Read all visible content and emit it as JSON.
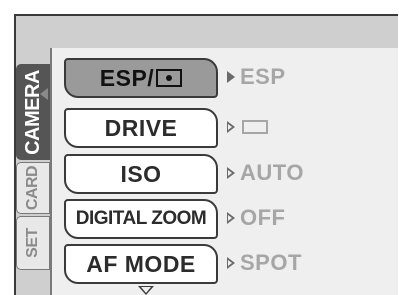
{
  "side_tabs": [
    {
      "label": "CAMERA",
      "active": true
    },
    {
      "label": "CARD",
      "active": false
    },
    {
      "label": "SET",
      "active": false
    }
  ],
  "menu": {
    "items": [
      {
        "label": "ESP/",
        "icon": "spot-metering-icon",
        "value": "ESP",
        "selected": true
      },
      {
        "label": "DRIVE",
        "value": "",
        "value_icon": "single-frame-icon",
        "selected": false
      },
      {
        "label": "ISO",
        "value": "AUTO",
        "selected": false
      },
      {
        "label": "DIGITAL ZOOM",
        "value": "OFF",
        "selected": false
      },
      {
        "label": "AF MODE",
        "value": "SPOT",
        "selected": false
      }
    ]
  },
  "colors": {
    "panel": "#efefef",
    "selected": "#9a9a9a",
    "active_tab": "#555555",
    "value_text": "#a6a6a6"
  }
}
